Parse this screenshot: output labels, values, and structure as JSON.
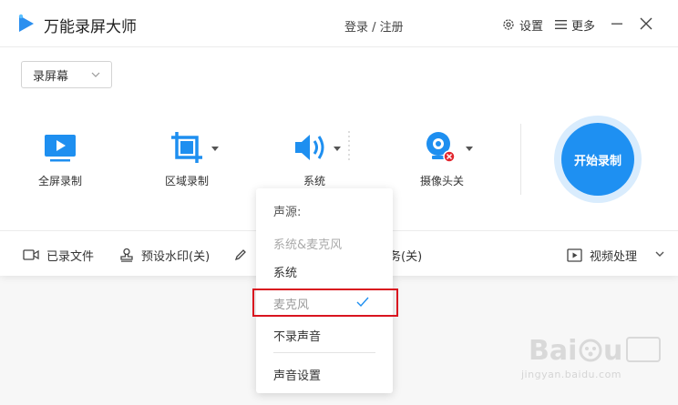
{
  "app": {
    "title": "万能录屏大师",
    "login": "登录 / 注册",
    "settings": "设置",
    "more": "更多"
  },
  "mode": {
    "selected": "录屏幕"
  },
  "tools": {
    "fullscreen": "全屏录制",
    "region": "区域录制",
    "audio": "系统",
    "camera": "摄像头关"
  },
  "record_button": "开始录制",
  "bottom": {
    "files": "已录文件",
    "watermark": "预设水印(关)",
    "task_suffix": "务(关)",
    "video": "视频处理"
  },
  "audio_menu": {
    "header": "声源:",
    "system_and_mic": "系统&麦克风",
    "system": "系统",
    "mic": "麦克风",
    "no_audio": "不录声音",
    "audio_settings": "声音设置"
  },
  "watermark": {
    "text": "jingyan.baidu.com"
  },
  "colors": {
    "accent": "#1e90f2",
    "highlight": "#d9141f"
  }
}
